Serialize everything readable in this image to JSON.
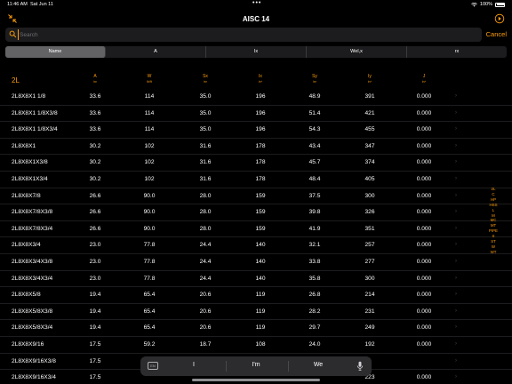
{
  "status_bar": {
    "time": "11:46 AM",
    "date": "Sat Jun 11",
    "battery": "100%"
  },
  "nav": {
    "title": "AISC 14"
  },
  "search": {
    "placeholder": "Search",
    "cancel_label": "Cancel"
  },
  "segments": [
    {
      "label": "Name",
      "active": true
    },
    {
      "label": "A",
      "active": false
    },
    {
      "label": "Ix",
      "active": false
    },
    {
      "label": "Wel,x",
      "active": false
    },
    {
      "label": "rx",
      "active": false
    }
  ],
  "table": {
    "title": "2L",
    "columns": [
      {
        "label": "A",
        "unit": "in²"
      },
      {
        "label": "W",
        "unit": "lb/ft"
      },
      {
        "label": "Sx",
        "unit": "in³"
      },
      {
        "label": "Ix",
        "unit": "in⁴"
      },
      {
        "label": "Sy",
        "unit": "in³"
      },
      {
        "label": "Iy",
        "unit": "in⁴"
      },
      {
        "label": "J",
        "unit": "in⁴"
      }
    ],
    "rows": [
      {
        "name": "2L8X8X1 1/8",
        "values": [
          "33.6",
          "114",
          "35.0",
          "196",
          "48.9",
          "391",
          "0.000"
        ]
      },
      {
        "name": "2L8X8X1 1/8X3/8",
        "values": [
          "33.6",
          "114",
          "35.0",
          "196",
          "51.4",
          "421",
          "0.000"
        ]
      },
      {
        "name": "2L8X8X1 1/8X3/4",
        "values": [
          "33.6",
          "114",
          "35.0",
          "196",
          "54.3",
          "455",
          "0.000"
        ]
      },
      {
        "name": "2L8X8X1",
        "values": [
          "30.2",
          "102",
          "31.6",
          "178",
          "43.4",
          "347",
          "0.000"
        ]
      },
      {
        "name": "2L8X8X1X3/8",
        "values": [
          "30.2",
          "102",
          "31.6",
          "178",
          "45.7",
          "374",
          "0.000"
        ]
      },
      {
        "name": "2L8X8X1X3/4",
        "values": [
          "30.2",
          "102",
          "31.6",
          "178",
          "48.4",
          "405",
          "0.000"
        ]
      },
      {
        "name": "2L8X8X7/8",
        "values": [
          "26.6",
          "90.0",
          "28.0",
          "159",
          "37.5",
          "300",
          "0.000"
        ]
      },
      {
        "name": "2L8X8X7/8X3/8",
        "values": [
          "26.6",
          "90.0",
          "28.0",
          "159",
          "39.8",
          "326",
          "0.000"
        ]
      },
      {
        "name": "2L8X8X7/8X3/4",
        "values": [
          "26.6",
          "90.0",
          "28.0",
          "159",
          "41.9",
          "351",
          "0.000"
        ]
      },
      {
        "name": "2L8X8X3/4",
        "values": [
          "23.0",
          "77.8",
          "24.4",
          "140",
          "32.1",
          "257",
          "0.000"
        ]
      },
      {
        "name": "2L8X8X3/4X3/8",
        "values": [
          "23.0",
          "77.8",
          "24.4",
          "140",
          "33.8",
          "277",
          "0.000"
        ]
      },
      {
        "name": "2L8X8X3/4X3/4",
        "values": [
          "23.0",
          "77.8",
          "24.4",
          "140",
          "35.8",
          "300",
          "0.000"
        ]
      },
      {
        "name": "2L8X8X5/8",
        "values": [
          "19.4",
          "65.4",
          "20.6",
          "119",
          "26.8",
          "214",
          "0.000"
        ]
      },
      {
        "name": "2L8X8X5/8X3/8",
        "values": [
          "19.4",
          "65.4",
          "20.6",
          "119",
          "28.2",
          "231",
          "0.000"
        ]
      },
      {
        "name": "2L8X8X5/8X3/4",
        "values": [
          "19.4",
          "65.4",
          "20.6",
          "119",
          "29.7",
          "249",
          "0.000"
        ]
      },
      {
        "name": "2L8X8X9/16",
        "values": [
          "17.5",
          "59.2",
          "18.7",
          "108",
          "24.0",
          "192",
          "0.000"
        ]
      },
      {
        "name": "2L8X8X9/16X3/8",
        "values": [
          "17.5",
          "",
          "",
          "",
          "",
          "",
          ""
        ]
      },
      {
        "name": "2L8X8X9/16X3/4",
        "values": [
          "17.5",
          "",
          "",
          "",
          "",
          "223",
          "0.000"
        ]
      }
    ]
  },
  "index": [
    "2L",
    "C",
    "HP",
    "HSS",
    "L",
    "M",
    "MC",
    "MT",
    "PIPE",
    "S",
    "ST",
    "W",
    "WT"
  ],
  "keyboard": {
    "suggestions": [
      "I",
      "I'm",
      "We"
    ]
  },
  "colors": {
    "accent": "#ff9f0a",
    "background": "#000000",
    "field": "#1c1c1e"
  }
}
